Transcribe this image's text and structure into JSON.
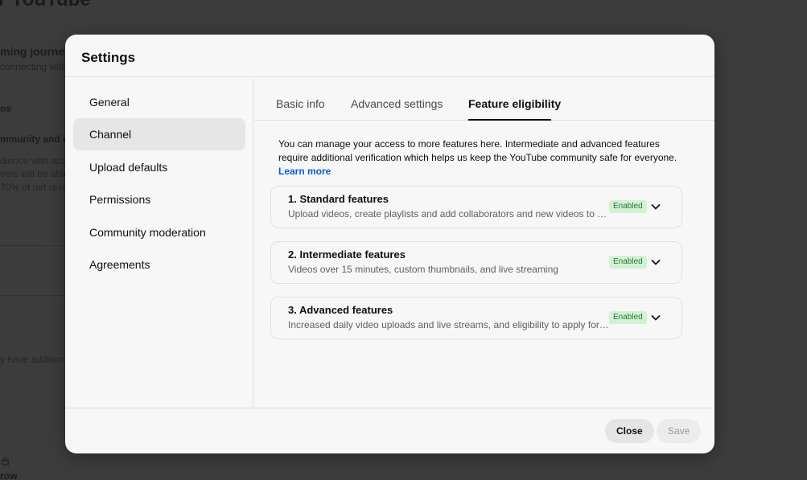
{
  "background": {
    "title": "r YouTube",
    "journey": "ming journey",
    "connecting": "connecting with y",
    "section_os": "os",
    "community": "mmunity and ea",
    "line1": "dience with acc",
    "line2": "vers will be able",
    "line3": "70% of net reve",
    "line4": "y have addition",
    "row": "row"
  },
  "dialog": {
    "title": "Settings"
  },
  "sidebar": {
    "items": [
      {
        "label": "General",
        "active": false
      },
      {
        "label": "Channel",
        "active": true
      },
      {
        "label": "Upload defaults",
        "active": false
      },
      {
        "label": "Permissions",
        "active": false
      },
      {
        "label": "Community moderation",
        "active": false
      },
      {
        "label": "Agreements",
        "active": false
      }
    ]
  },
  "tabs": [
    {
      "label": "Basic info",
      "active": false
    },
    {
      "label": "Advanced settings",
      "active": false
    },
    {
      "label": "Feature eligibility",
      "active": true
    }
  ],
  "content": {
    "intro": "You can manage your access to more features here. Intermediate and advanced features require additional verification which helps us keep the YouTube community safe for everyone.",
    "learn_more": "Learn more",
    "features": [
      {
        "title": "1. Standard features",
        "description": "Upload videos, create playlists and add collaborators and new videos to playlists",
        "status": "Enabled"
      },
      {
        "title": "2. Intermediate features",
        "description": "Videos over 15 minutes, custom thumbnails, and live streaming",
        "status": "Enabled"
      },
      {
        "title": "3. Advanced features",
        "description": "Increased daily video uploads and live streams, and eligibility to apply for monetization",
        "status": "Enabled"
      }
    ]
  },
  "footer": {
    "close_label": "Close",
    "save_label": "Save"
  },
  "colors": {
    "accent_link": "#065fd4",
    "badge_bg": "#d4f1d6",
    "badge_text": "#1f7a31"
  }
}
